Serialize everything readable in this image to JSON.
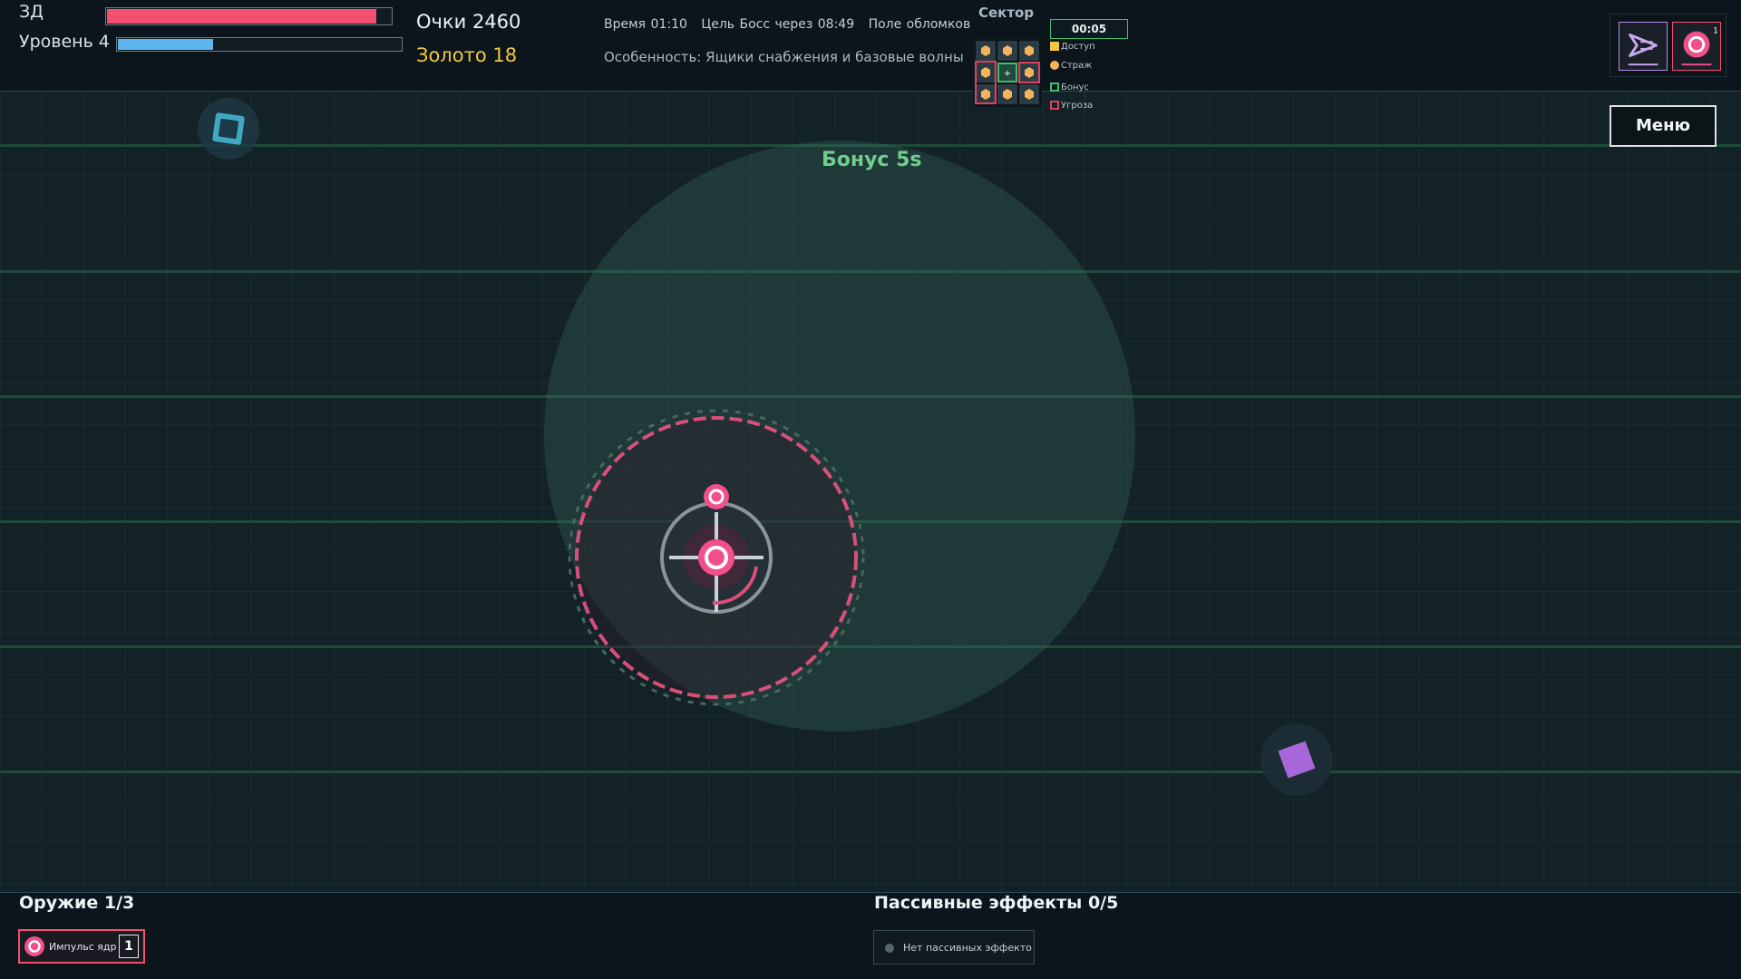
{
  "hud": {
    "hp_label": "ЗД",
    "hp_fraction": 0.95,
    "level_label": "Уровень 4",
    "xp_fraction": 0.34,
    "score": "Очки 2460",
    "gold": "Золото 18",
    "time": "Время 01:10",
    "goal": "Цель Босс через 08:49",
    "field": "Поле обломков",
    "feature": "Особенность: Ящики снабжения и базовые волны"
  },
  "sector": {
    "title": "Сектор",
    "timer": "00:05",
    "legend": [
      {
        "label": "Доступ",
        "color": "#f2c744"
      },
      {
        "label": "Страж",
        "color": "#f5b35a"
      },
      {
        "label": "Бонус",
        "color": "#3fbf6a"
      },
      {
        "label": "Угроза",
        "color": "#e0405c"
      }
    ]
  },
  "top_right": {
    "dash_icon": "dash-arrow-icon",
    "core_icon": "core-ring-icon",
    "core_badge": "1"
  },
  "menu": {
    "label": "Меню"
  },
  "arena": {
    "bonus_text": "Бонус 5s"
  },
  "weapons": {
    "title": "Оружие 1/3",
    "items": [
      {
        "name": "Импульс ядр",
        "level": "1",
        "icon": "core-pulse-icon"
      }
    ]
  },
  "passives": {
    "title": "Пассивные эффекты 0/5",
    "empty_text": "Нет пассивных эффекто"
  },
  "colors": {
    "accent_pink": "#f2506e",
    "xp_blue": "#5fb5ee",
    "gold": "#f2c744",
    "bonus_green": "#6fcf8f",
    "enemy_purple": "#a867d8",
    "pickup_cyan": "#3fa9c4"
  }
}
